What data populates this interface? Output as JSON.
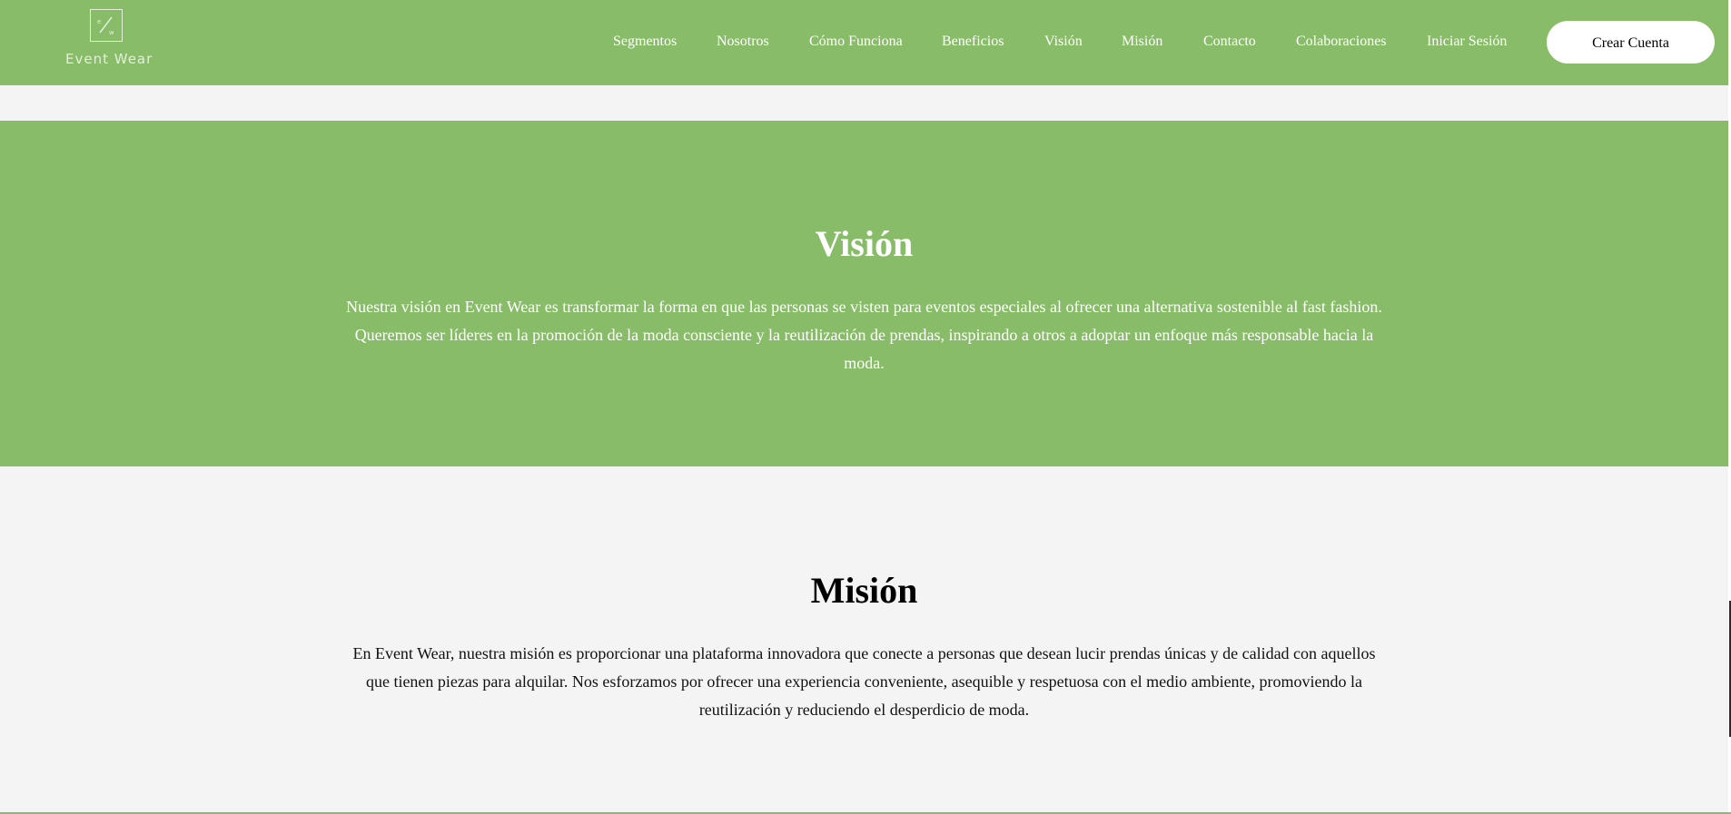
{
  "brand": {
    "name": "Event Wear"
  },
  "nav": {
    "items": [
      {
        "label": "Segmentos"
      },
      {
        "label": "Nosotros"
      },
      {
        "label": "Cómo Funciona"
      },
      {
        "label": "Beneficios"
      },
      {
        "label": "Visión"
      },
      {
        "label": "Misión"
      },
      {
        "label": "Contacto"
      },
      {
        "label": "Colaboraciones"
      },
      {
        "label": "Iniciar Sesión"
      }
    ],
    "cta_label": "Crear Cuenta"
  },
  "vision": {
    "title": "Visión",
    "text": "Nuestra visión en Event Wear es transformar la forma en que las personas se visten para eventos especiales al ofrecer una alternativa sostenible al fast fashion. Queremos ser líderes en la promoción de la moda consciente y la reutilización de prendas, inspirando a otros a adoptar un enfoque más responsable hacia la moda."
  },
  "mission": {
    "title": "Misión",
    "text": "En Event Wear, nuestra misión es proporcionar una plataforma innovadora que conecte a personas que desean lucir prendas únicas y de calidad con aquellos que tienen piezas para alquilar. Nos esforzamos por ofrecer una experiencia conveniente, asequible y respetuosa con el medio ambiente, promoviendo la reutilización y reduciendo el desperdicio de moda."
  },
  "colors": {
    "accent_green": "#88bc69",
    "page_background": "#f4f4f4",
    "button_background": "#ffffff"
  },
  "icons": {
    "logo": "event-wear-logo-icon"
  }
}
